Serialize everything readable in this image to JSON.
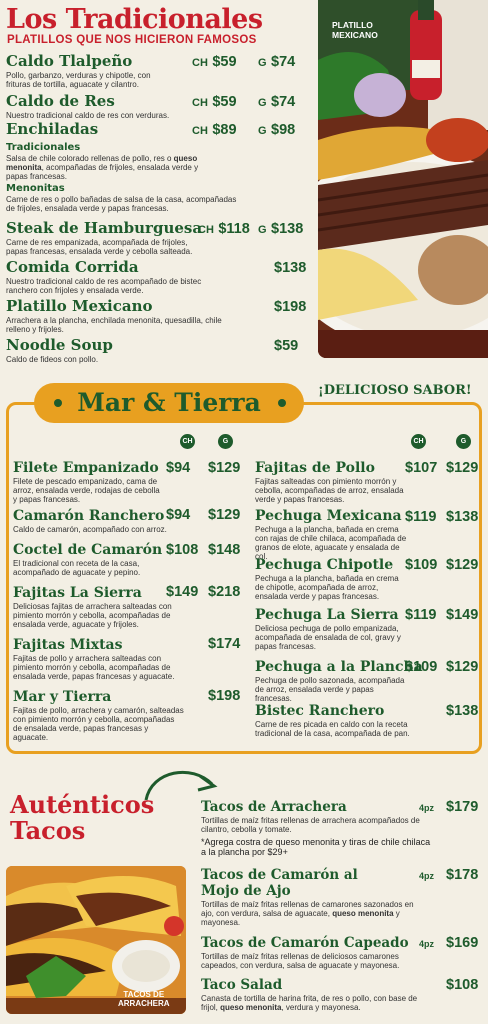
{
  "tradicionales": {
    "title": "Los Tradicionales",
    "subtitle": "PLATILLOS QUE NOS HICIERON FAMOSOS",
    "size_ch": "CH",
    "size_g": "G",
    "items": [
      {
        "name": "Caldo Tlalpeño",
        "ch": "$59",
        "g": "$74",
        "desc": "Pollo, garbanzo, verduras y chipotle, con frituras de tortilla, aguacate y cilantro."
      },
      {
        "name": "Caldo de Res",
        "ch": "$59",
        "g": "$74",
        "desc": "Nuestro tradicional caldo de res con verduras."
      },
      {
        "name": "Enchiladas",
        "ch": "$89",
        "g": "$98"
      },
      {
        "name": "Steak de Hamburguesa",
        "ch": "$118",
        "g": "$138",
        "desc": "Carne de res empanizada, acompañada de frijoles, papas francesas, ensalada verde y cebolla salteada."
      },
      {
        "name": "Comida Corrida",
        "price": "$138",
        "desc": "Nuestro tradicional caldo de res acompañado de bistec ranchero con frijoles y ensalada verde."
      },
      {
        "name": "Platillo Mexicano",
        "price": "$198",
        "desc": "Arrachera a la plancha, enchilada menonita, quesadilla, chile relleno y frijoles."
      },
      {
        "name": "Noodle Soup",
        "price": "$59",
        "desc": "Caldo de fideos con pollo."
      }
    ],
    "enchiladas_sub": [
      {
        "name": "Tradicionales",
        "desc_a": "Salsa de chile colorado rellenas de pollo, res o ",
        "desc_bold": "queso menonita",
        "desc_b": ", acompañadas de frijoles, ensalada verde y papas francesas."
      },
      {
        "name": "Menonitas",
        "desc": "Carne de res o pollo bañadas de salsa de la casa, acompañadas de frijoles, ensalada verde y papas francesas."
      }
    ],
    "photo_label": "PLATILLO\nMEXICANO"
  },
  "mar_tierra": {
    "title": "Mar & Tierra",
    "slogan": "¡DELICIOSO SABOR!",
    "col_ch": "CH",
    "col_g": "G",
    "left": [
      {
        "name": "Filete Empanizado",
        "ch": "$94",
        "g": "$129",
        "desc": "Filete de pescado empanizado, cama de arroz, ensalada verde, rodajas de cebolla y papas francesas."
      },
      {
        "name": "Camarón Ranchero",
        "ch": "$94",
        "g": "$129",
        "desc": "Caldo de camarón, acompañado con arroz."
      },
      {
        "name": "Coctel de Camarón",
        "ch": "$108",
        "g": "$148",
        "desc": "El tradicional con receta de la casa, acompañado de aguacate y pepino."
      },
      {
        "name": "Fajitas La Sierra",
        "ch": "$149",
        "g": "$218",
        "desc": "Deliciosas fajitas de arrachera salteadas con pimiento morrón y cebolla, acompañadas de ensalada verde, aguacate y frijoles."
      },
      {
        "name": "Fajitas Mixtas",
        "price": "$174",
        "desc": "Fajitas de pollo y arrachera salteadas con pimiento morrón y cebolla, acompañadas de ensalada verde, papas francesas y aguacate."
      },
      {
        "name": "Mar y Tierra",
        "price": "$198",
        "desc": "Fajitas de pollo, arrachera y camarón, salteadas con pimiento morrón y cebolla, acompañadas de ensalada verde, papas francesas y aguacate."
      }
    ],
    "right": [
      {
        "name": "Fajitas de Pollo",
        "ch": "$107",
        "g": "$129",
        "desc": "Fajitas salteadas con pimiento morrón y cebolla, acompañadas de arroz, ensalada verde y papas francesas."
      },
      {
        "name": "Pechuga Mexicana",
        "ch": "$119",
        "g": "$138",
        "desc": "Pechuga a la plancha, bañada en crema con rajas de chile chilaca, acompañada de granos de elote, aguacate y ensalada de col."
      },
      {
        "name": "Pechuga Chipotle",
        "ch": "$109",
        "g": "$129",
        "desc": "Pechuga a la plancha, bañada en crema de chipotle, acompañada de arroz, ensalada verde y papas francesas."
      },
      {
        "name": "Pechuga La Sierra",
        "ch": "$119",
        "g": "$149",
        "desc": "Deliciosa pechuga de pollo empanizada, acompañada de ensalada de col, gravy y papas francesas."
      },
      {
        "name": "Pechuga a la Plancha",
        "ch": "$109",
        "g": "$129",
        "desc": "Pechuga de pollo sazonada, acompañada de arroz, ensalada verde y papas francesas."
      },
      {
        "name": "Bistec Ranchero",
        "price": "$138",
        "desc": "Carne de res picada en caldo con la receta tradicional de la casa, acompañada de pan."
      }
    ]
  },
  "autenticos": {
    "title_line1": "Auténticos",
    "title_line2": "Tacos",
    "photo_label": "TACOS DE\nARRACHERA",
    "items": [
      {
        "name": "Tacos de Arrachera",
        "pz": "4pz",
        "price": "$179",
        "desc": "Tortillas de maíz fritas rellenas de arrachera acompañados de cilantro, cebolla y tomate.",
        "note": "*Agrega costra de queso menonita y tiras de chile chilaca a la plancha por $29+"
      },
      {
        "name_line1": "Tacos de Camarón al",
        "name_line2": "Mojo de Ajo",
        "pz": "4pz",
        "price": "$178",
        "desc_a": "Tortillas de maíz fritas rellenas de camarones sazonados en ajo, con verdura, salsa de aguacate, ",
        "desc_bold": "queso menonita",
        "desc_b": " y mayonesa."
      },
      {
        "name": "Tacos de Camarón Capeado",
        "pz": "4pz",
        "price": "$169",
        "desc": "Tortillas de maíz fritas rellenas de deliciosos camarones capeados, con verdura, salsa de aguacate y mayonesa."
      },
      {
        "name": "Taco Salad",
        "price": "$108",
        "desc_a": "Canasta de tortilla de harina frita, de res o pollo, con base de frijol, ",
        "desc_bold": "queso menonita",
        "desc_b": ", verdura y mayonesa."
      }
    ]
  },
  "colors": {
    "green": "#1e5b2c",
    "red": "#c8202c",
    "gold": "#e8a020",
    "paper": "#f3efe4"
  }
}
